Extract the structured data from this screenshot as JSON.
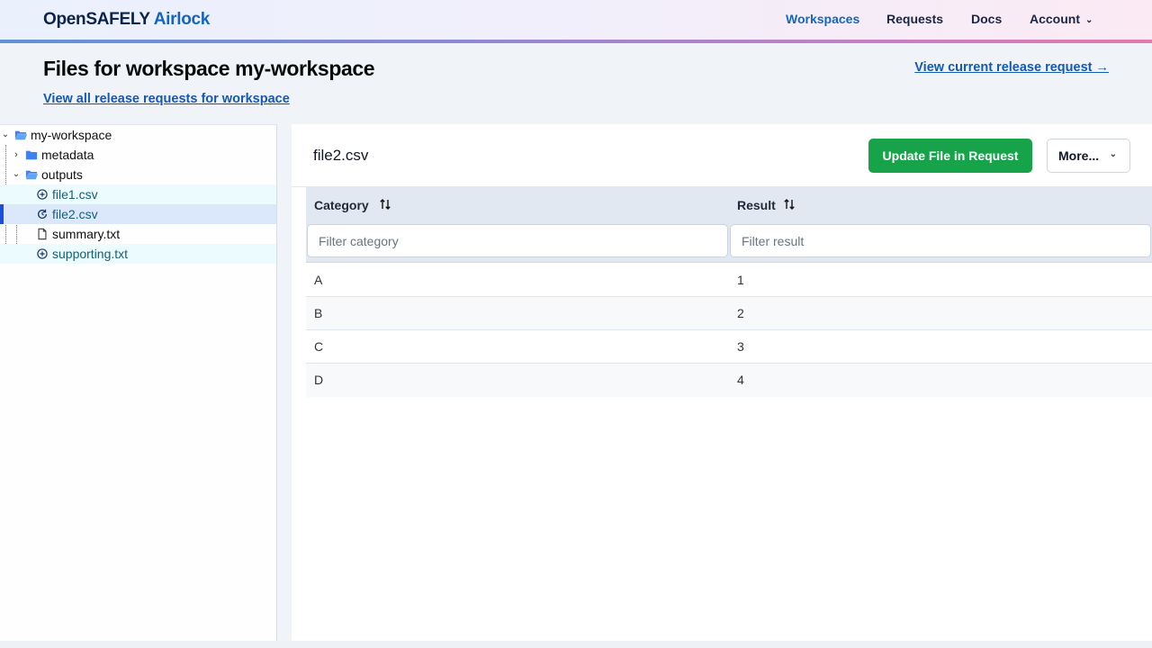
{
  "header": {
    "brand_primary": "OpenSAFELY",
    "brand_secondary": "Airlock",
    "nav": [
      {
        "label": "Workspaces",
        "active": true
      },
      {
        "label": "Requests",
        "active": false
      },
      {
        "label": "Docs",
        "active": false
      },
      {
        "label": "Account",
        "active": false,
        "has_dropdown": true
      }
    ]
  },
  "page": {
    "title": "Files for workspace my-workspace",
    "link_all_requests": "View all release requests for workspace",
    "link_current_request": "View current release request →"
  },
  "tree": {
    "items": [
      {
        "label": "my-workspace",
        "type": "folder-open",
        "expanded": true,
        "state": "normal"
      },
      {
        "label": "metadata",
        "type": "folder",
        "expanded": false,
        "state": "normal"
      },
      {
        "label": "outputs",
        "type": "folder-open",
        "expanded": true,
        "state": "normal"
      },
      {
        "label": "file1.csv",
        "type": "file-added",
        "state": "added"
      },
      {
        "label": "file2.csv",
        "type": "file-updated",
        "state": "selected"
      },
      {
        "label": "summary.txt",
        "type": "file",
        "state": "normal"
      },
      {
        "label": "supporting.txt",
        "type": "file-added",
        "state": "added"
      }
    ]
  },
  "content": {
    "file_title": "file2.csv",
    "update_button": "Update File in Request",
    "more_button": "More...",
    "table": {
      "columns": [
        {
          "label": "Category",
          "filter_placeholder": "Filter category"
        },
        {
          "label": "Result",
          "filter_placeholder": "Filter result"
        }
      ],
      "rows": [
        [
          "A",
          "1"
        ],
        [
          "B",
          "2"
        ],
        [
          "C",
          "3"
        ],
        [
          "D",
          "4"
        ]
      ]
    }
  },
  "colors": {
    "accent": "#1565c0",
    "success_button": "#17a34a",
    "selected_row": "#dbe8fb",
    "added_row": "#ecfbfd"
  }
}
